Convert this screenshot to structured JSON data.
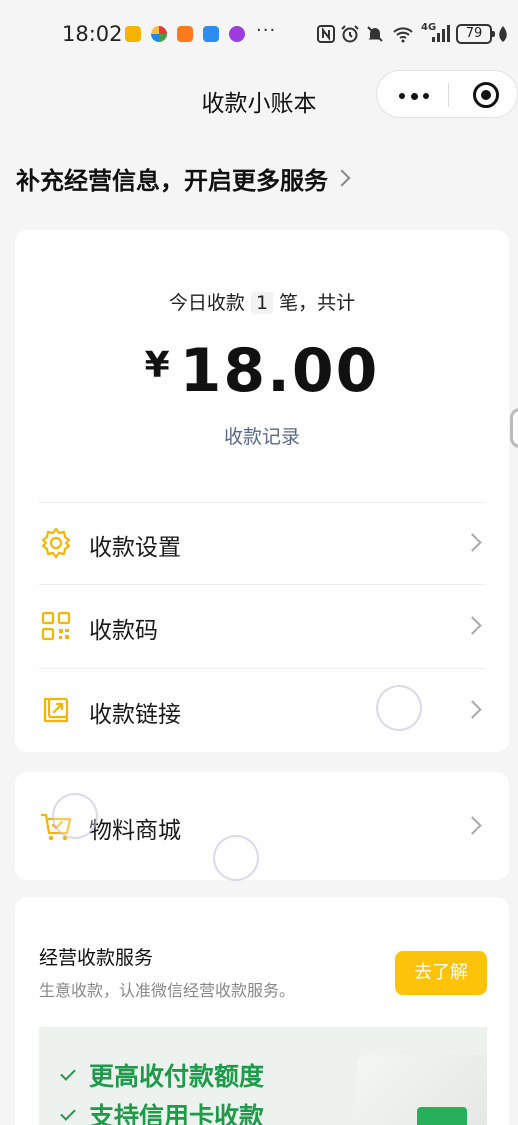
{
  "status_bar": {
    "time": "18:02",
    "more": "···",
    "network": "4G",
    "battery": "79",
    "icons": [
      "mail-app-icon",
      "pinwheel-app-icon",
      "orange-app-icon",
      "weather-app-icon",
      "music-app-icon",
      "nfc-icon",
      "alarm-icon",
      "mute-icon",
      "wifi-icon",
      "signal-icon",
      "leaf-icon"
    ]
  },
  "nav": {
    "title": "收款小账本"
  },
  "promo": {
    "text": "补充经营信息，开启更多服务"
  },
  "summary": {
    "today_prefix": "今日收款",
    "today_count": "1",
    "today_suffix": "笔，共计",
    "currency": "¥",
    "amount": "18.00",
    "records_link": "收款记录"
  },
  "menu": {
    "items": [
      {
        "label": "收款设置",
        "icon": "gear-icon"
      },
      {
        "label": "收款码",
        "icon": "qr-code-icon"
      },
      {
        "label": "收款链接",
        "icon": "link-icon"
      }
    ]
  },
  "mall": {
    "label": "物料商城",
    "icon": "cart-icon"
  },
  "service": {
    "title": "经营收款服务",
    "subtitle": "生意收款，认准微信经营收款服务。",
    "button": "去了解",
    "features": [
      "更高收付款额度",
      "支持信用卡收款"
    ]
  },
  "colors": {
    "accent_yellow": "#fcc30a",
    "link_blue": "#5a6a8a",
    "feature_green": "#1f9a4a",
    "background": "#f5f5f5"
  }
}
